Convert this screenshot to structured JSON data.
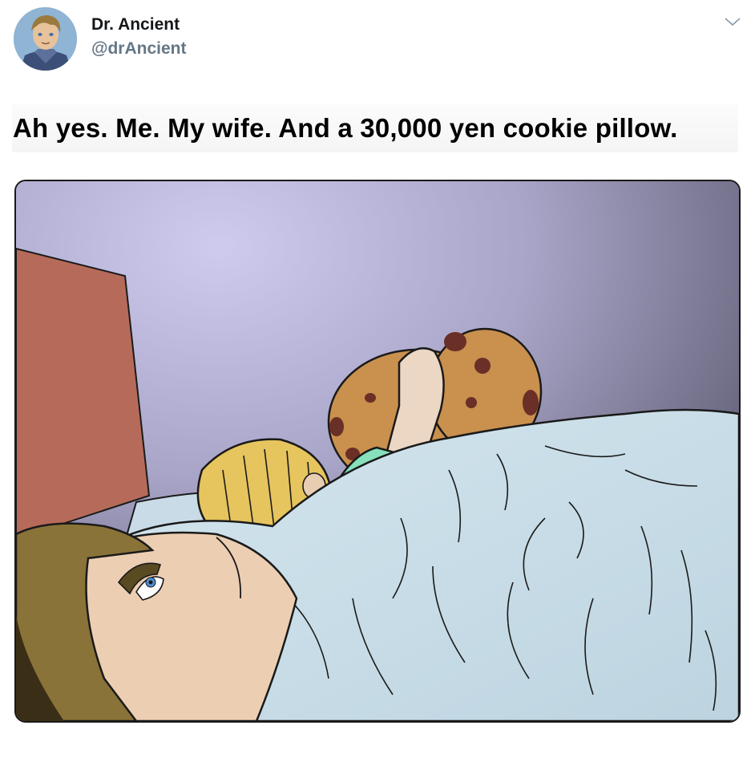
{
  "author": {
    "display_name": "Dr. Ancient",
    "handle": "@drAncient"
  },
  "tweet": {
    "text": "Ah yes. Me. My wife. And a 30,000 yen cookie pillow."
  },
  "icons": {
    "menu": "chevron-down-icon",
    "avatar": "avatar"
  },
  "colors": {
    "name": "#14171a",
    "handle": "#657786",
    "blanket": "#c5dbe6",
    "cookie": "#c9904e",
    "headboard": "#b66b5a"
  }
}
